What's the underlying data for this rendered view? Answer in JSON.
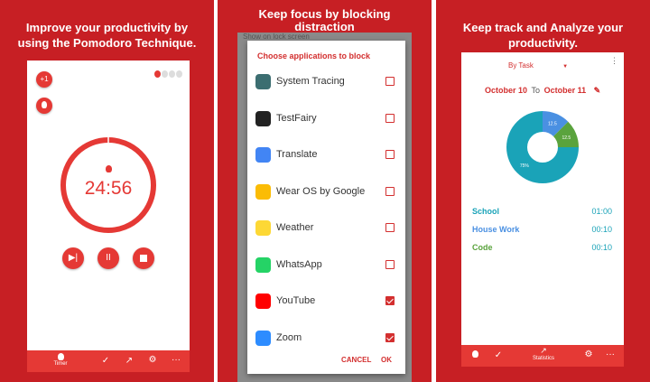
{
  "panel1": {
    "caption_line1": "Improve your productivity by",
    "caption_line2": "using the Pomodoro Technique.",
    "plus_badge": "+1",
    "timer": "24:56",
    "progress": 0.997,
    "nav": {
      "timer_label": "Timer",
      "more": "···"
    }
  },
  "panel2": {
    "caption_line1": "Keep focus by blocking",
    "caption_line2": "distraction",
    "bg_fragment": "Show on lock screen",
    "dialog_title": "Choose applications to block",
    "apps": [
      {
        "name": "System Tracing",
        "checked": false,
        "color": "#3c6e71"
      },
      {
        "name": "TestFairy",
        "checked": false,
        "color": "#222222"
      },
      {
        "name": "Translate",
        "checked": false,
        "color": "#4285f4"
      },
      {
        "name": "Wear OS by Google",
        "checked": false,
        "color": "#fbbc05"
      },
      {
        "name": "Weather",
        "checked": false,
        "color": "#fdd835"
      },
      {
        "name": "WhatsApp",
        "checked": false,
        "color": "#25d366"
      },
      {
        "name": "YouTube",
        "checked": true,
        "color": "#ff0000"
      },
      {
        "name": "Zoom",
        "checked": true,
        "color": "#2d8cff"
      }
    ],
    "cancel_label": "CANCEL",
    "ok_label": "OK"
  },
  "panel3": {
    "caption_line1": "Keep track and Analyze your",
    "caption_line2": "productivity.",
    "group_by": "By Task",
    "date_from": "October 10",
    "date_to_word": "To",
    "date_to": "October 11",
    "nav_label": "Statistics",
    "more": "···"
  },
  "chart_data": {
    "type": "pie",
    "categories": [
      "Code",
      "House Work",
      "School"
    ],
    "values": [
      12.5,
      12.5,
      75
    ],
    "labels": [
      "12.5",
      "12.5",
      "75%"
    ],
    "colors": [
      "#4a90e2",
      "#5aa33d",
      "#1aa3b8"
    ],
    "donut": true
  },
  "stats": [
    {
      "name": "School",
      "time": "01:00",
      "color": "#1aa3b8"
    },
    {
      "name": "House Work",
      "time": "00:10",
      "color": "#4a90e2"
    },
    {
      "name": "Code",
      "time": "00:10",
      "color": "#5aa33d"
    }
  ]
}
